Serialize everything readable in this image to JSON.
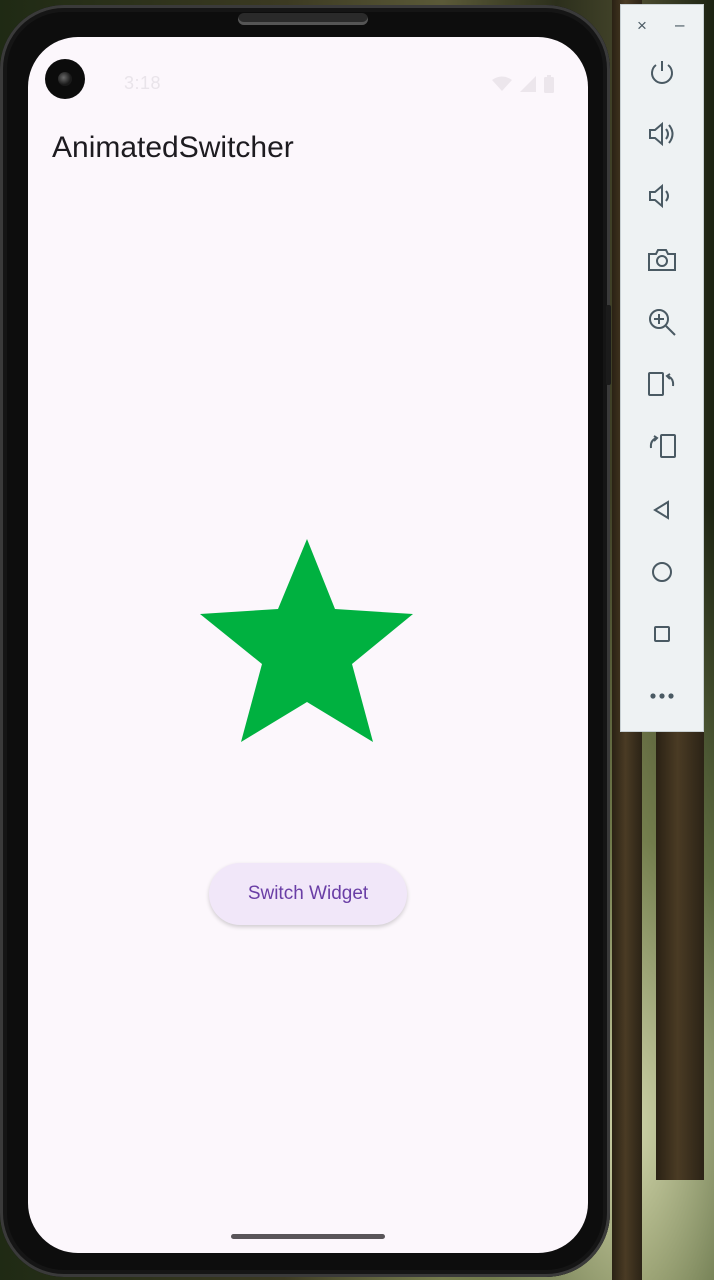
{
  "status_bar": {
    "time": "3:18"
  },
  "app": {
    "title": "AnimatedSwitcher"
  },
  "content": {
    "shape_icon": "star-icon",
    "shape_color": "#00b140"
  },
  "button": {
    "label": "Switch Widget"
  },
  "emulator_toolbar": {
    "window_controls": {
      "close": "×",
      "minimize": "–"
    },
    "buttons": [
      "power-icon",
      "volume-up-icon",
      "volume-down-icon",
      "camera-icon",
      "zoom-in-icon",
      "rotate-left-icon",
      "rotate-right-icon",
      "back-icon",
      "home-icon",
      "overview-icon",
      "more-icon"
    ]
  },
  "colors": {
    "screen_bg": "#fcf7fc",
    "button_bg": "#f1e7f9",
    "button_text": "#6a3ea6",
    "star": "#00b140"
  }
}
